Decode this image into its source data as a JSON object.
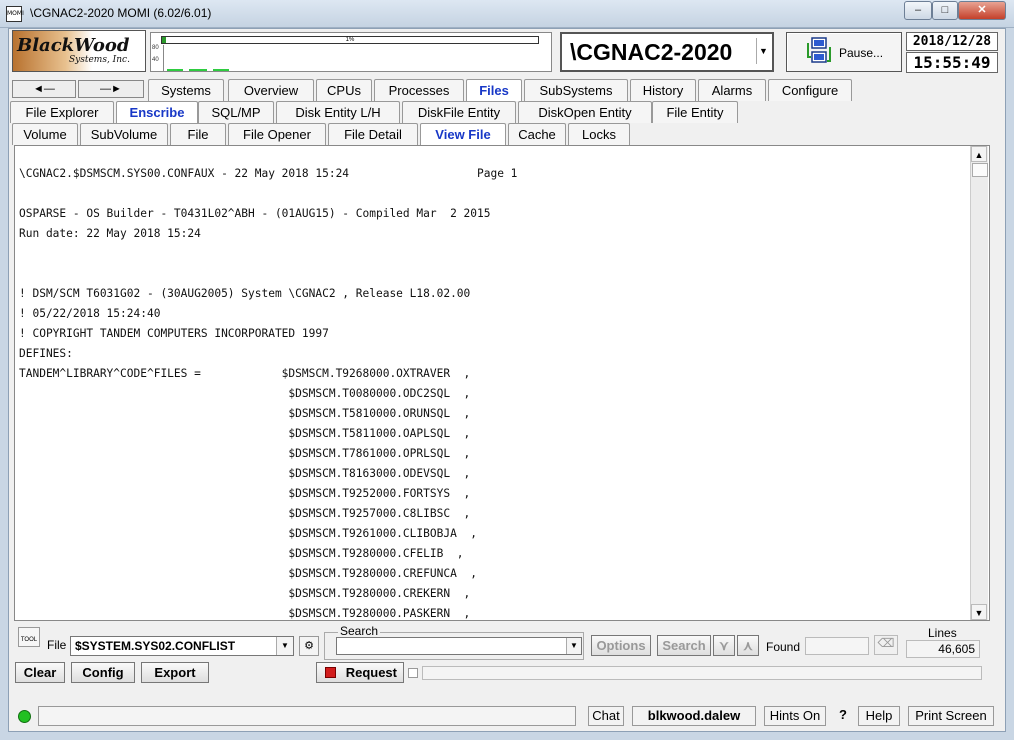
{
  "window": {
    "title": "\\CGNAC2-2020 MOMI (6.02/6.01)",
    "app_icon_text": "MOMI",
    "minimize": "–",
    "maximize": "□",
    "close": "✕"
  },
  "logo": {
    "main": "BlackWood",
    "sub": "Systems, Inc."
  },
  "graph": {
    "bar_label": "1%",
    "bar_fill_fraction": 0.01,
    "axis_labels": [
      "80",
      "40"
    ],
    "accent": "#2ecc40"
  },
  "system": {
    "name": "\\CGNAC2-2020",
    "dropdown_icon": "chevron-down-icon"
  },
  "pause": {
    "label": "Pause..."
  },
  "clock": {
    "date": "2018/12/28",
    "time": "15:55:49"
  },
  "nav": {
    "back": "◄—",
    "forward": "—►"
  },
  "tabs_level1": [
    "Systems",
    "Overview",
    "CPUs",
    "Processes",
    "Files",
    "SubSystems",
    "History",
    "Alarms",
    "Configure"
  ],
  "tabs_level1_active": "Files",
  "tabs_level2": [
    "File Explorer",
    "Enscribe",
    "SQL/MP",
    "Disk Entity L/H",
    "DiskFile Entity",
    "DiskOpen Entity",
    "File Entity"
  ],
  "tabs_level2_active": "Enscribe",
  "tabs_level3": [
    "Volume",
    "SubVolume",
    "File",
    "File Opener",
    "File Detail",
    "View File",
    "Cache",
    "Locks"
  ],
  "tabs_level3_active": "View File",
  "file_view": {
    "lines": [
      "\\CGNAC2.$DSMSCM.SYS00.CONFAUX - 22 May 2018 15:24                   Page 1",
      "",
      "OSPARSE - OS Builder - T0431L02^ABH - (01AUG15) - Compiled Mar  2 2015",
      "Run date: 22 May 2018 15:24",
      "",
      "",
      "! DSM/SCM T6031G02 - (30AUG2005) System \\CGNAC2 , Release L18.02.00",
      "! 05/22/2018 15:24:40",
      "! COPYRIGHT TANDEM COMPUTERS INCORPORATED 1997",
      "DEFINES:",
      "TANDEM^LIBRARY^CODE^FILES =            $DSMSCM.T9268000.OXTRAVER  ,",
      "                                        $DSMSCM.T0080000.ODC2SQL  ,",
      "                                        $DSMSCM.T5810000.ORUNSQL  ,",
      "                                        $DSMSCM.T5811000.OAPLSQL  ,",
      "                                        $DSMSCM.T7861000.OPRLSQL  ,",
      "                                        $DSMSCM.T8163000.ODEVSQL  ,",
      "                                        $DSMSCM.T9252000.FORTSYS  ,",
      "                                        $DSMSCM.T9257000.C8LIBSC  ,",
      "                                        $DSMSCM.T9261000.CLIBOBJA  ,",
      "                                        $DSMSCM.T9280000.CFELIB  ,",
      "                                        $DSMSCM.T9280000.CREFUNCA  ,",
      "                                        $DSMSCM.T9280000.CREKERN  ,",
      "                                        $DSMSCM.T9280000.PASKERN  ,"
    ]
  },
  "toolbar": {
    "tool_label": "TOOL",
    "file_label": "File",
    "file_value": "$SYSTEM.SYS02.CONFLIST",
    "search_group_label": "Search",
    "options_label": "Options",
    "search_label": "Search",
    "found_label": "Found",
    "lines_label": "Lines",
    "lines_value": "46,605",
    "clear_label": "Clear",
    "config_label": "Config",
    "export_label": "Export",
    "request_label": "Request"
  },
  "status_bar": {
    "chat_label": "Chat",
    "user": "blkwood.dalew",
    "hints_label": "Hints On",
    "help_q": "?",
    "help_label": "Help",
    "print_label": "Print Screen",
    "status_color": "#22c022"
  }
}
